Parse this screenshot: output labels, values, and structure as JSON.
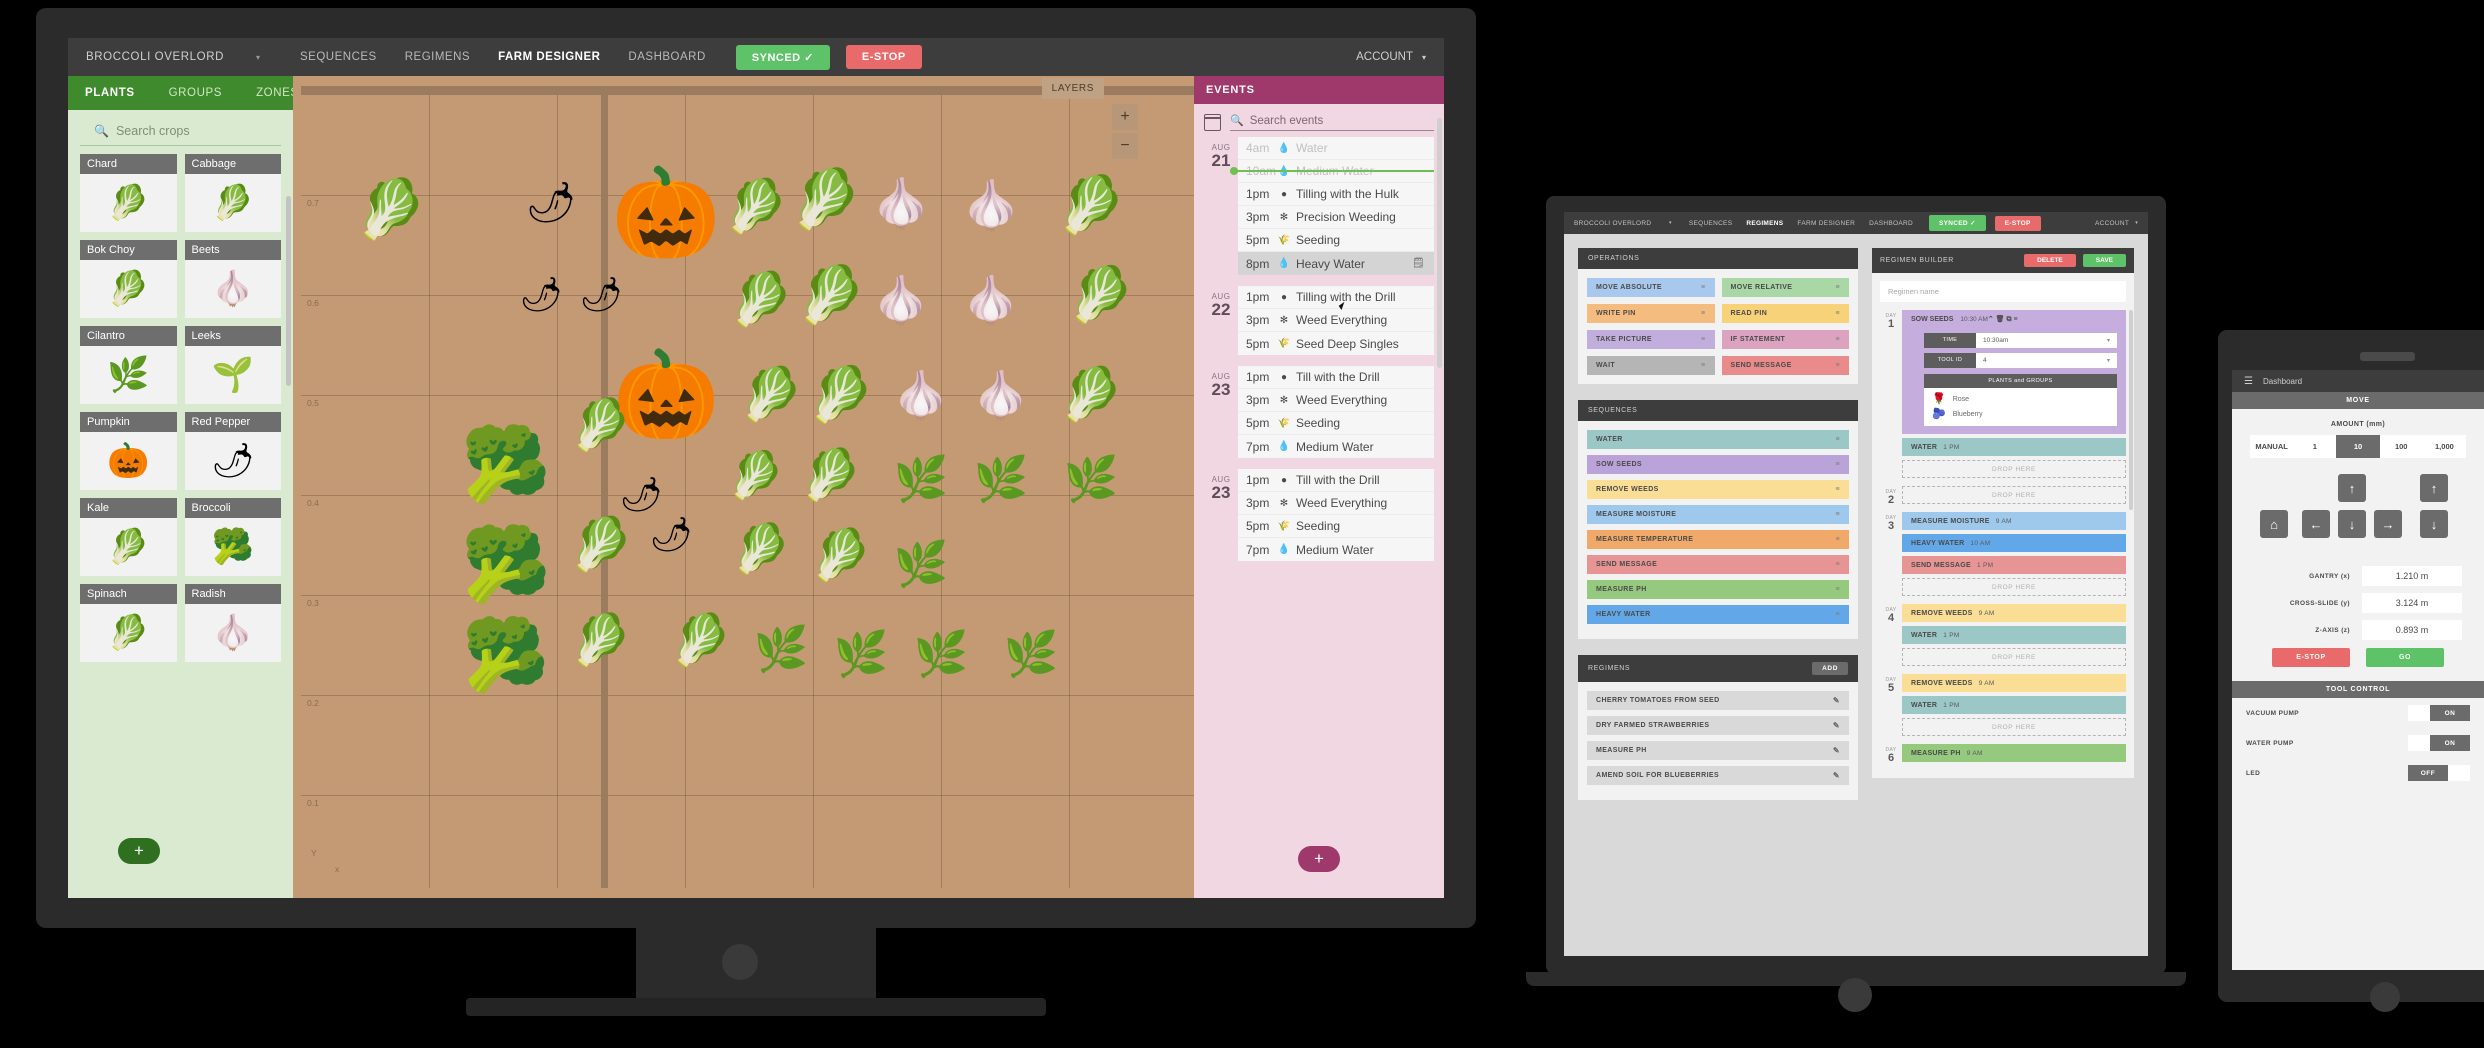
{
  "topbar": {
    "brand": "BROCCOLI OVERLORD",
    "caret": "▾",
    "links": [
      "SEQUENCES",
      "REGIMENS",
      "FARM DESIGNER",
      "DASHBOARD"
    ],
    "active": "FARM DESIGNER",
    "synced": "SYNCED ✓",
    "estop": "E-STOP",
    "account": "ACCOUNT"
  },
  "farm_designer": {
    "tabs": [
      "PLANTS",
      "GROUPS",
      "ZONES"
    ],
    "active_tab": "PLANTS",
    "search_placeholder": "Search crops",
    "crops": [
      {
        "name": "Chard",
        "glyph": "🥬"
      },
      {
        "name": "Cabbage",
        "glyph": "🥬"
      },
      {
        "name": "Bok Choy",
        "glyph": "🥬"
      },
      {
        "name": "Beets",
        "glyph": "🧄"
      },
      {
        "name": "Cilantro",
        "glyph": "🌿"
      },
      {
        "name": "Leeks",
        "glyph": "🌱"
      },
      {
        "name": "Pumpkin",
        "glyph": "🎃"
      },
      {
        "name": "Red Pepper",
        "glyph": "🌶"
      },
      {
        "name": "Kale",
        "glyph": "🥬"
      },
      {
        "name": "Broccoli",
        "glyph": "🥦"
      },
      {
        "name": "Spinach",
        "glyph": "🥬"
      },
      {
        "name": "Radish",
        "glyph": "🧄"
      }
    ],
    "add_label": "+",
    "map": {
      "layers_label": "LAYERS",
      "zoom_in": "+",
      "zoom_out": "−",
      "axis_x": "x",
      "axis_y": "Y",
      "y_ticks": [
        "0.7",
        "0.6",
        "0.5",
        "0.4",
        "0.3",
        "0.2",
        "0.1"
      ]
    }
  },
  "events": {
    "title": "EVENTS",
    "search_placeholder": "Search events",
    "add_label": "+",
    "groups": [
      {
        "month": "AUG",
        "day": "21",
        "now_after": 1,
        "rows": [
          {
            "time": "4am",
            "icon": "💧",
            "name": "Water",
            "state": "past"
          },
          {
            "time": "10am",
            "icon": "💧",
            "name": "Medium Water",
            "state": "past"
          },
          {
            "time": "1pm",
            "icon": "●",
            "name": "Tilling with the Hulk",
            "state": ""
          },
          {
            "time": "3pm",
            "icon": "✻",
            "name": "Precision Weeding",
            "state": ""
          },
          {
            "time": "5pm",
            "icon": "🌾",
            "name": "Seeding",
            "state": ""
          },
          {
            "time": "8pm",
            "icon": "💧",
            "name": "Heavy Water",
            "state": "sel"
          }
        ]
      },
      {
        "month": "AUG",
        "day": "22",
        "now_after": -1,
        "rows": [
          {
            "time": "1pm",
            "icon": "●",
            "name": "Tilling with the Drill",
            "state": ""
          },
          {
            "time": "3pm",
            "icon": "✻",
            "name": "Weed Everything",
            "state": ""
          },
          {
            "time": "5pm",
            "icon": "🌾",
            "name": "Seed Deep Singles",
            "state": ""
          }
        ]
      },
      {
        "month": "AUG",
        "day": "23",
        "now_after": -1,
        "rows": [
          {
            "time": "1pm",
            "icon": "●",
            "name": "Till with the Drill",
            "state": ""
          },
          {
            "time": "3pm",
            "icon": "✻",
            "name": "Weed Everything",
            "state": ""
          },
          {
            "time": "5pm",
            "icon": "🌾",
            "name": "Seeding",
            "state": ""
          },
          {
            "time": "7pm",
            "icon": "💧",
            "name": "Medium Water",
            "state": ""
          }
        ]
      },
      {
        "month": "AUG",
        "day": "23",
        "now_after": -1,
        "rows": [
          {
            "time": "1pm",
            "icon": "●",
            "name": "Till with the Drill",
            "state": ""
          },
          {
            "time": "3pm",
            "icon": "✻",
            "name": "Weed Everything",
            "state": ""
          },
          {
            "time": "5pm",
            "icon": "🌾",
            "name": "Seeding",
            "state": ""
          },
          {
            "time": "7pm",
            "icon": "💧",
            "name": "Medium Water",
            "state": ""
          }
        ]
      }
    ]
  },
  "laptop": {
    "topbar": {
      "brand": "BROCCOLI OVERLORD",
      "links": [
        "SEQUENCES",
        "REGIMENS",
        "FARM DESIGNER",
        "DASHBOARD"
      ],
      "active": "REGIMENS",
      "synced": "SYNCED ✓",
      "estop": "E-STOP",
      "account": "ACCOUNT"
    },
    "operations": {
      "title": "OPERATIONS",
      "items": [
        {
          "label": "MOVE ABSOLUTE",
          "color": "#a8c8ee"
        },
        {
          "label": "MOVE RELATIVE",
          "color": "#a9d8a6"
        },
        {
          "label": "WRITE PIN",
          "color": "#f5bc80"
        },
        {
          "label": "READ PIN",
          "color": "#f7d278"
        },
        {
          "label": "TAKE PICTURE",
          "color": "#c2aedd"
        },
        {
          "label": "IF STATEMENT",
          "color": "#dba3c0"
        },
        {
          "label": "WAIT",
          "color": "#b5b5b5"
        },
        {
          "label": "SEND MESSAGE",
          "color": "#e98b8b"
        }
      ]
    },
    "sequences": {
      "title": "SEQUENCES",
      "items": [
        {
          "label": "WATER",
          "color": "#9cc7c7"
        },
        {
          "label": "SOW SEEDS",
          "color": "#b9a3d8"
        },
        {
          "label": "REMOVE WEEDS",
          "color": "#fade95"
        },
        {
          "label": "MEASURE MOISTURE",
          "color": "#9ec8ec"
        },
        {
          "label": "MEASURE TEMPERATURE",
          "color": "#f0a968"
        },
        {
          "label": "SEND MESSAGE",
          "color": "#e79494"
        },
        {
          "label": "MEASURE PH",
          "color": "#94c97e"
        },
        {
          "label": "HEAVY WATER",
          "color": "#62a8e8"
        }
      ]
    },
    "regimens": {
      "title": "REGIMENS",
      "add_label": "ADD",
      "items": [
        "CHERRY TOMATOES FROM SEED",
        "DRY FARMED STRAWBERRIES",
        "MEASURE PH",
        "AMEND SOIL FOR BLUEBERRIES"
      ]
    },
    "builder": {
      "title": "REGIMEN BUILDER",
      "delete_label": "DELETE",
      "save_label": "SAVE",
      "name_placeholder": "Regimen name",
      "drop_label": "DROP HERE",
      "day_label": "DAY",
      "sow": {
        "title": "SOW SEEDS",
        "time": "10:30 AM",
        "fields": [
          {
            "label": "TIME",
            "value": "10:30am",
            "caret": "▾"
          },
          {
            "label": "TOOL ID",
            "value": "4",
            "caret": "▾"
          }
        ],
        "plants_header": "PLANTS and GROUPS",
        "plants": [
          {
            "name": "Rose",
            "glyph": "🌹"
          },
          {
            "name": "Blueberry",
            "glyph": "🫐"
          }
        ],
        "icons": "⌃ 🗑 ⧉ ≡"
      },
      "days": [
        {
          "day": "1",
          "items": [
            {
              "label": "WATER",
              "time": "1 PM",
              "color": "#9cc7c7"
            }
          ],
          "drops": 1
        },
        {
          "day": "2",
          "items": [],
          "drops": 1
        },
        {
          "day": "3",
          "items": [
            {
              "label": "MEASURE MOISTURE",
              "time": "9 AM",
              "color": "#9ec8ec"
            },
            {
              "label": "HEAVY WATER",
              "time": "10 AM",
              "color": "#62a8e8"
            },
            {
              "label": "SEND MESSAGE",
              "time": "1 PM",
              "color": "#e79494"
            }
          ],
          "drops": 1
        },
        {
          "day": "4",
          "items": [
            {
              "label": "REMOVE WEEDS",
              "time": "9 AM",
              "color": "#fade95"
            },
            {
              "label": "WATER",
              "time": "1 PM",
              "color": "#9cc7c7"
            }
          ],
          "drops": 1
        },
        {
          "day": "5",
          "items": [
            {
              "label": "REMOVE WEEDS",
              "time": "9 AM",
              "color": "#fade95"
            },
            {
              "label": "WATER",
              "time": "1 PM",
              "color": "#9cc7c7"
            }
          ],
          "drops": 1
        },
        {
          "day": "6",
          "items": [
            {
              "label": "MEASURE PH",
              "time": "9 AM",
              "color": "#94c97e"
            }
          ],
          "drops": 0
        }
      ]
    }
  },
  "tablet": {
    "nav_title": "Dashboard",
    "move_title": "MOVE",
    "amount_label": "AMOUNT (mm)",
    "amounts": [
      "MANUAL",
      "1",
      "10",
      "100",
      "1,000"
    ],
    "amount_selected": "10",
    "dpad": {
      "up": "↑",
      "down": "↓",
      "left": "←",
      "right": "→",
      "home": "⌂",
      "z_up": "↑",
      "z_down": "↓"
    },
    "coords": [
      {
        "label": "GANTRY (x)",
        "value": "1.210 m"
      },
      {
        "label": "CROSS-SLIDE (y)",
        "value": "3.124 m"
      },
      {
        "label": "Z-AXIS (z)",
        "value": "0.893 m"
      }
    ],
    "estop_label": "E-STOP",
    "go_label": "GO",
    "tool_title": "TOOL CONTROL",
    "tools": [
      {
        "label": "VACUUM PUMP",
        "state": "ON"
      },
      {
        "label": "WATER PUMP",
        "state": "ON"
      },
      {
        "label": "LED",
        "state": "OFF"
      }
    ]
  }
}
